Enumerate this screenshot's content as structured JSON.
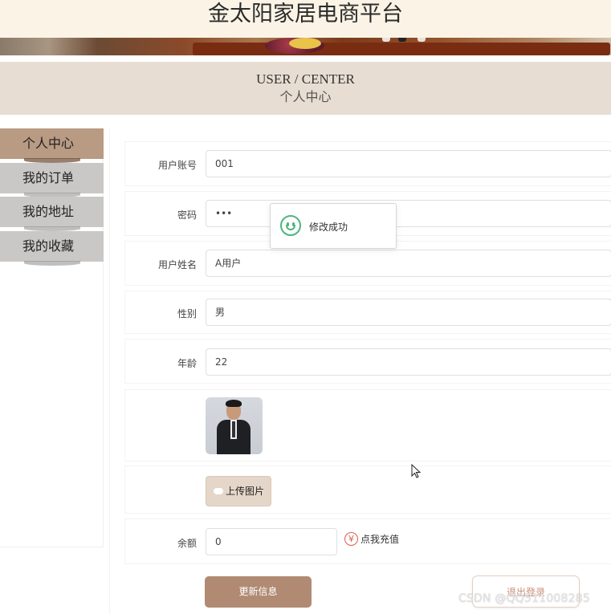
{
  "site": {
    "title": "金太阳家居电商平台"
  },
  "header": {
    "en": "USER / CENTER",
    "cn": "个人中心"
  },
  "sidebar": {
    "items": [
      {
        "label": "个人中心",
        "active": true
      },
      {
        "label": "我的订单"
      },
      {
        "label": "我的地址"
      },
      {
        "label": "我的收藏"
      }
    ]
  },
  "form": {
    "account": {
      "label": "用户账号",
      "value": "001"
    },
    "password": {
      "label": "密码",
      "value": "•••"
    },
    "name": {
      "label": "用户姓名",
      "value": "A用户"
    },
    "gender": {
      "label": "性别",
      "value": "男"
    },
    "age": {
      "label": "年龄",
      "value": "22"
    },
    "upload_label": "上传图片",
    "balance": {
      "label": "余额",
      "value": "0"
    },
    "recharge": {
      "icon": "yen-icon",
      "label": "点我充值"
    }
  },
  "actions": {
    "update": "更新信息",
    "logout": "退出登录"
  },
  "toast": {
    "message": "修改成功",
    "icon": "smile-icon",
    "color": "#4cb57d"
  },
  "watermark": "CSDN @QQ511008285",
  "colors": {
    "accent": "#b08a72",
    "sidebar_active": "#b99a83",
    "header_bg": "#e8ddd2",
    "topbar_bg": "#fbf4e6"
  }
}
